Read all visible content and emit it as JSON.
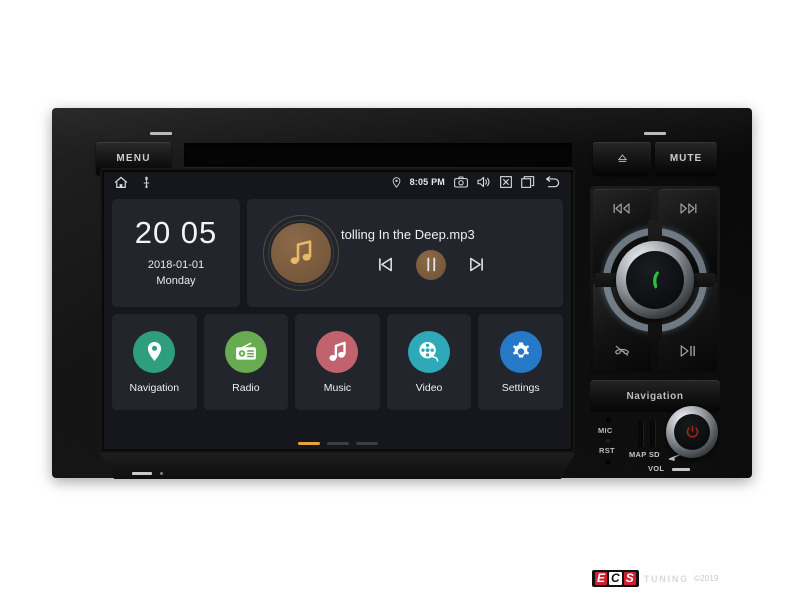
{
  "device": {
    "name": "car-head-unit",
    "menu_button_label": "MENU",
    "mute_button_label": "MUTE",
    "eject_icon": "eject-icon",
    "navigation_button_label": "Navigation",
    "mic_label": "MIC",
    "reset_label": "RST",
    "map_sd_label": "MAP SD",
    "volume_label": "VOL",
    "cluster_buttons": [
      {
        "name": "prev-track-hard-button",
        "icon": "skip-previous-icon"
      },
      {
        "name": "next-track-hard-button",
        "icon": "skip-next-icon"
      },
      {
        "name": "hang-up-hard-button",
        "icon": "phone-hangup-icon"
      },
      {
        "name": "play-pause-hard-button",
        "icon": "play-pause-icon"
      }
    ],
    "center_knob_icon": "phone-call-icon",
    "center_knob_icon_color": "#2fbf3f",
    "power_knob_icon": "power-icon",
    "power_knob_icon_color": "#a62218"
  },
  "screen": {
    "statusbar": {
      "left_icons": [
        {
          "name": "home-icon",
          "label": "home"
        },
        {
          "name": "usb-icon",
          "label": "usb"
        }
      ],
      "location_icon": "location-pin-icon",
      "time": "8:05 PM",
      "right_icons": [
        {
          "name": "camera-icon",
          "label": "camera"
        },
        {
          "name": "volume-icon",
          "label": "volume"
        },
        {
          "name": "close-box-icon",
          "label": "close"
        },
        {
          "name": "recents-icon",
          "label": "recents"
        },
        {
          "name": "back-icon",
          "label": "back"
        }
      ]
    },
    "clock_widget": {
      "time": "20 05",
      "date": "2018-01-01",
      "weekday": "Monday"
    },
    "music_widget": {
      "album_icon": "music-note-icon",
      "track_title": "tolling In the Deep.mp3",
      "prev_label": "previous",
      "play_state_icon": "pause-icon",
      "next_label": "next"
    },
    "apps": [
      {
        "label": "Navigation",
        "icon": "map-pin-icon",
        "color": "#2e9e7e"
      },
      {
        "label": "Radio",
        "icon": "radio-icon",
        "color": "#69ab51"
      },
      {
        "label": "Music",
        "icon": "music-note-icon",
        "color": "#c1636e"
      },
      {
        "label": "Video",
        "icon": "film-reel-icon",
        "color": "#2fa8b8"
      },
      {
        "label": "Settings",
        "icon": "gear-icon",
        "color": "#2679c8"
      }
    ],
    "pager": {
      "pages": 3,
      "active_index": 0,
      "active_color": "#e8a33a"
    }
  },
  "watermark": {
    "brand_e": "E",
    "brand_c": "C",
    "brand_s": "S",
    "brand_word": "TUNING",
    "copyright": "©2019"
  }
}
